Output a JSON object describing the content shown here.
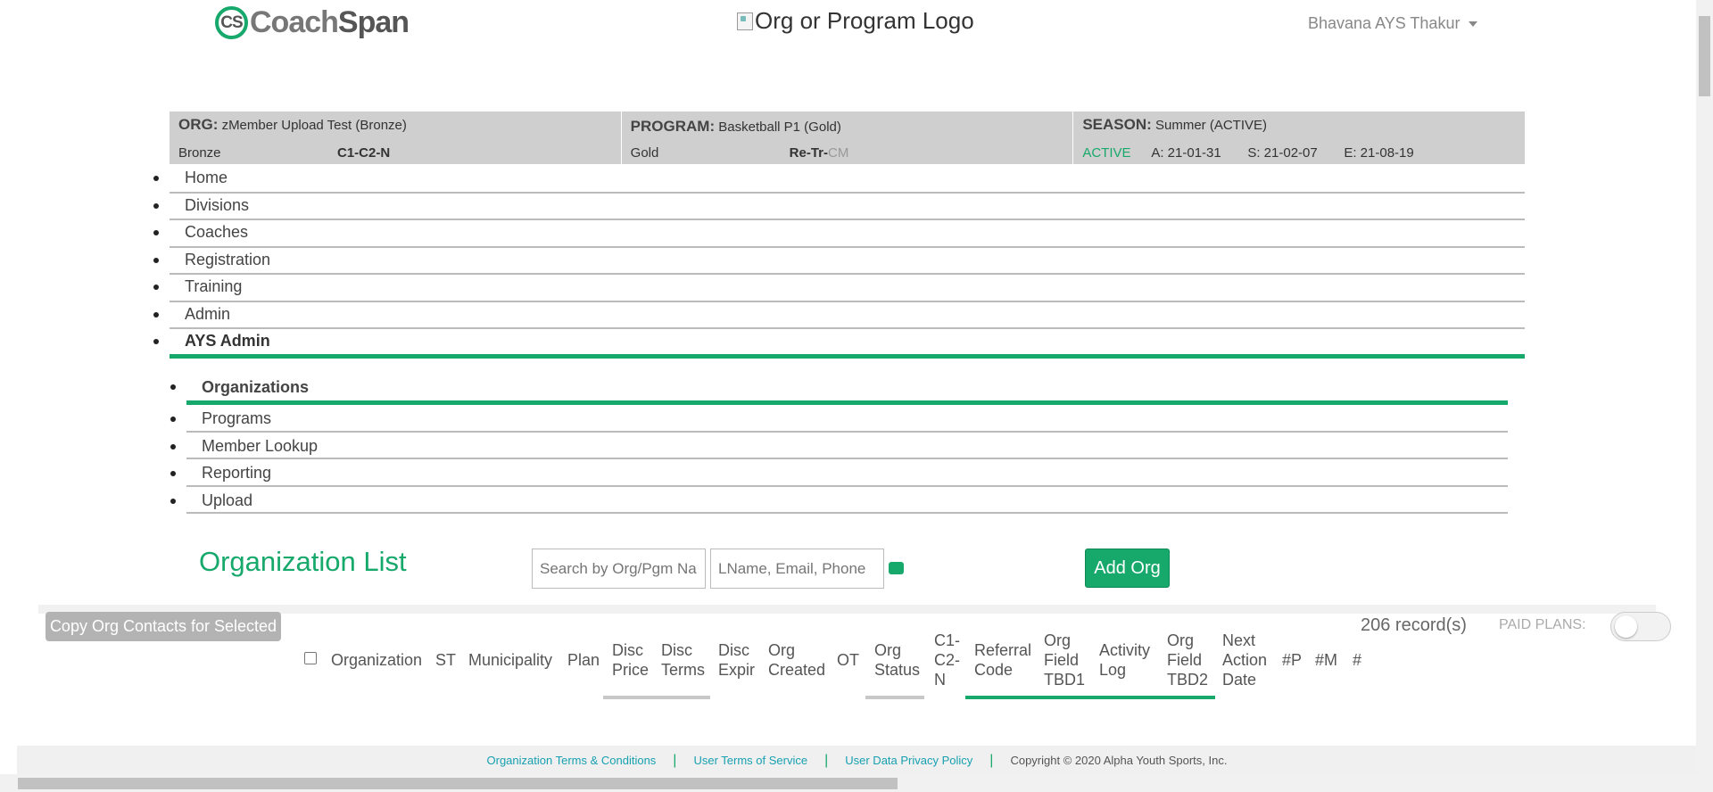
{
  "header": {
    "brand_cs": "CS",
    "brand_coach": "Coach",
    "brand_span": "Span",
    "org_logo_alt": "Org or Program Logo",
    "user_name": "Bhavana AYS Thakur"
  },
  "context": {
    "org": {
      "label": "ORG:",
      "value": "zMember Upload Test (Bronze)",
      "plan": "Bronze",
      "code": "C1-C2-N"
    },
    "program": {
      "label": "PROGRAM:",
      "value": "Basketball P1 (Gold)",
      "plan": "Gold",
      "code_a": "Re-Tr-",
      "code_b": "CM"
    },
    "season": {
      "label": "SEASON:",
      "value": "Summer (ACTIVE)",
      "status": "ACTIVE",
      "a_date": "A: 21-01-31",
      "s_date": "S: 21-02-07",
      "e_date": "E: 21-08-19"
    }
  },
  "nav": {
    "items": [
      "Home",
      "Divisions",
      "Coaches",
      "Registration",
      "Training",
      "Admin",
      "AYS Admin"
    ]
  },
  "subnav": {
    "items": [
      "Organizations",
      "Programs",
      "Member Lookup",
      "Reporting",
      "Upload"
    ]
  },
  "main": {
    "title": "Organization List",
    "search_org_placeholder": "Search by Org/Pgm Na",
    "search_contact_placeholder": "LName, Email, Phone",
    "add_button": "Add Org",
    "copy_button": "Copy Org Contacts for Selected",
    "records": "206 record(s)",
    "paid_plans_label": "PAID PLANS:"
  },
  "table": {
    "columns": [
      [
        "Organization"
      ],
      [
        "ST"
      ],
      [
        "Municipality"
      ],
      [
        "Plan"
      ],
      [
        "Disc",
        "Price"
      ],
      [
        "Disc",
        "Terms"
      ],
      [
        "Disc",
        "Expir"
      ],
      [
        "Org",
        "Created"
      ],
      [
        "OT"
      ],
      [
        "Org",
        "Status"
      ],
      [
        "C1-",
        "C2-",
        "N"
      ],
      [
        "Referral",
        "Code"
      ],
      [
        "Org",
        "Field",
        "TBD1"
      ],
      [
        "Activity",
        "Log"
      ],
      [
        "Org",
        "Field",
        "TBD2"
      ],
      [
        "Next",
        "Action",
        "Date"
      ],
      [
        "#P"
      ],
      [
        "#M"
      ],
      [
        "#"
      ]
    ]
  },
  "footer": {
    "links": [
      "Organization Terms & Conditions",
      "User Terms of Service",
      "User Data Privacy Policy"
    ],
    "copyright": "Copyright © 2020 Alpha Youth Sports, Inc."
  },
  "colors": {
    "accent": "#17a86b",
    "context_bg": "#cfcfcf",
    "link": "#17a0b0"
  }
}
